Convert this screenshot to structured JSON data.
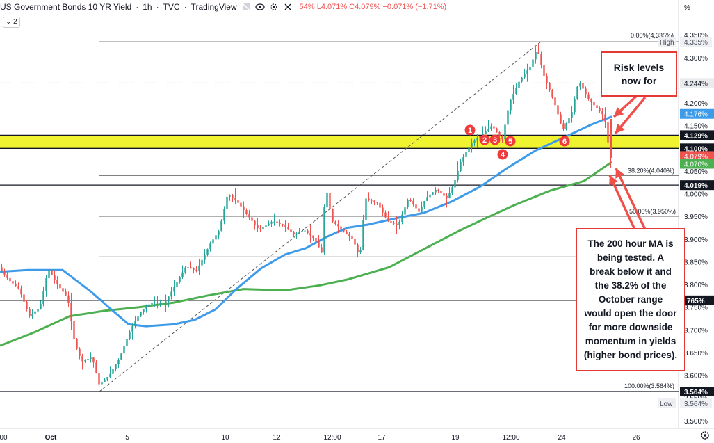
{
  "header": {
    "title": "US Government Bonds 10 YR Yield",
    "interval": "1h",
    "source": "TVC",
    "platform": "TradingView",
    "ohlc_text": "54% L4.071% C4.079% −0.071% (−1.71%)",
    "collapse_label": "2"
  },
  "notes": {
    "risk": "Risk levels\nnow for",
    "ma": "The 200 hour MA is\nbeing tested. A\nbreak below it and\nthe 38.2% of the\nOctober range\nwould open the door\nfor more downside\nmomentum in yields\n(higher bond prices)."
  },
  "axis_top_tag": "%",
  "chart_data": {
    "type": "candlestick",
    "title": "US Government Bonds 10 YR Yield",
    "ylim": [
      3.49,
      4.39
    ],
    "y_ticks": [
      "4.350%",
      "4.300%",
      "4.250%",
      "4.200%",
      "4.150%",
      "4.100%",
      "4.050%",
      "4.000%",
      "3.950%",
      "3.900%",
      "3.850%",
      "3.800%",
      "3.750%",
      "3.700%",
      "3.650%",
      "3.600%",
      "3.550%",
      "3.500%"
    ],
    "x_ticks": [
      "00",
      "Oct",
      "5",
      "10",
      "12",
      "12:00",
      "17",
      "19",
      "12:00",
      "24",
      "26"
    ],
    "price_tags": [
      {
        "label": "High",
        "value": "4.335%",
        "kind": "plain"
      },
      {
        "label": "",
        "value": "4.244%",
        "kind": "dark"
      },
      {
        "label": "",
        "value": "4.176%",
        "kind": "blue"
      },
      {
        "label": "",
        "value": "4.129%",
        "kind": "black"
      },
      {
        "label": "",
        "value": "4.100%",
        "kind": "black"
      },
      {
        "label": "",
        "value": "4.079%",
        "kind": "red"
      },
      {
        "label": "",
        "value": "4.070%",
        "kind": "green"
      },
      {
        "label": "",
        "value": "4.019%",
        "kind": "black"
      },
      {
        "label": "",
        "value": "765%",
        "kind": "black"
      },
      {
        "label": "",
        "value": "3.564%",
        "kind": "black"
      },
      {
        "label": "Low",
        "value": "3.564%",
        "kind": "plain"
      }
    ],
    "fib_levels": [
      {
        "label": "0.00%(4.335%)",
        "value": 4.335
      },
      {
        "label": "38.20%(4.040%)",
        "value": 4.04
      },
      {
        "label": "50.00%(3.950%)",
        "value": 3.95
      },
      {
        "label": "100.00%(3.564%)",
        "value": 3.564
      }
    ],
    "extra_levels": [
      4.244,
      3.861,
      4.019,
      3.765
    ],
    "support_zone": [
      4.1,
      4.129
    ],
    "markers": [
      "1",
      "2",
      "3",
      "4",
      "5",
      "6"
    ],
    "ma_100_points": [
      [
        0,
        3.828
      ],
      [
        40,
        3.832
      ],
      [
        90,
        3.832
      ],
      [
        130,
        3.785
      ],
      [
        160,
        3.745
      ],
      [
        185,
        3.712
      ],
      [
        210,
        3.708
      ],
      [
        250,
        3.712
      ],
      [
        280,
        3.722
      ],
      [
        310,
        3.745
      ],
      [
        340,
        3.79
      ],
      [
        375,
        3.835
      ],
      [
        410,
        3.866
      ],
      [
        440,
        3.88
      ],
      [
        470,
        3.905
      ],
      [
        500,
        3.925
      ],
      [
        530,
        3.932
      ],
      [
        570,
        3.946
      ],
      [
        610,
        3.958
      ],
      [
        650,
        3.983
      ],
      [
        690,
        4.015
      ],
      [
        730,
        4.057
      ],
      [
        770,
        4.095
      ],
      [
        810,
        4.123
      ],
      [
        850,
        4.152
      ],
      [
        880,
        4.17
      ]
    ],
    "ma_200_points": [
      [
        0,
        3.665
      ],
      [
        50,
        3.695
      ],
      [
        100,
        3.73
      ],
      [
        150,
        3.742
      ],
      [
        200,
        3.75
      ],
      [
        250,
        3.76
      ],
      [
        300,
        3.776
      ],
      [
        350,
        3.79
      ],
      [
        410,
        3.787
      ],
      [
        460,
        3.798
      ],
      [
        500,
        3.811
      ],
      [
        560,
        3.838
      ],
      [
        610,
        3.878
      ],
      [
        660,
        3.918
      ],
      [
        700,
        3.947
      ],
      [
        740,
        3.975
      ],
      [
        790,
        4.006
      ],
      [
        840,
        4.028
      ],
      [
        880,
        4.07
      ]
    ],
    "price_path": [
      [
        0,
        3.84
      ],
      [
        15,
        3.81
      ],
      [
        30,
        3.79
      ],
      [
        45,
        3.73
      ],
      [
        60,
        3.75
      ],
      [
        72,
        3.835
      ],
      [
        85,
        3.8
      ],
      [
        100,
        3.77
      ],
      [
        110,
        3.67
      ],
      [
        120,
        3.63
      ],
      [
        135,
        3.64
      ],
      [
        145,
        3.58
      ],
      [
        160,
        3.6
      ],
      [
        175,
        3.64
      ],
      [
        190,
        3.7
      ],
      [
        205,
        3.74
      ],
      [
        220,
        3.76
      ],
      [
        240,
        3.76
      ],
      [
        255,
        3.8
      ],
      [
        270,
        3.84
      ],
      [
        285,
        3.83
      ],
      [
        305,
        3.89
      ],
      [
        318,
        3.92
      ],
      [
        330,
        4.0
      ],
      [
        345,
        3.98
      ],
      [
        360,
        3.95
      ],
      [
        375,
        3.92
      ],
      [
        395,
        3.94
      ],
      [
        410,
        3.93
      ],
      [
        425,
        3.91
      ],
      [
        440,
        3.92
      ],
      [
        455,
        3.9
      ],
      [
        465,
        3.87
      ],
      [
        471,
        4.02
      ],
      [
        480,
        3.94
      ],
      [
        495,
        3.92
      ],
      [
        510,
        3.9
      ],
      [
        520,
        3.86
      ],
      [
        528,
        3.99
      ],
      [
        545,
        3.98
      ],
      [
        560,
        3.94
      ],
      [
        575,
        3.93
      ],
      [
        590,
        3.99
      ],
      [
        605,
        3.96
      ],
      [
        615,
        3.99
      ],
      [
        630,
        4.01
      ],
      [
        645,
        3.99
      ],
      [
        655,
        4.02
      ],
      [
        665,
        4.07
      ],
      [
        680,
        4.11
      ],
      [
        695,
        4.13
      ],
      [
        710,
        4.15
      ],
      [
        725,
        4.12
      ],
      [
        735,
        4.2
      ],
      [
        750,
        4.25
      ],
      [
        765,
        4.28
      ],
      [
        775,
        4.32
      ],
      [
        785,
        4.26
      ],
      [
        800,
        4.2
      ],
      [
        812,
        4.14
      ],
      [
        825,
        4.18
      ],
      [
        835,
        4.25
      ],
      [
        848,
        4.21
      ],
      [
        860,
        4.19
      ],
      [
        872,
        4.17
      ],
      [
        880,
        4.079
      ]
    ]
  }
}
